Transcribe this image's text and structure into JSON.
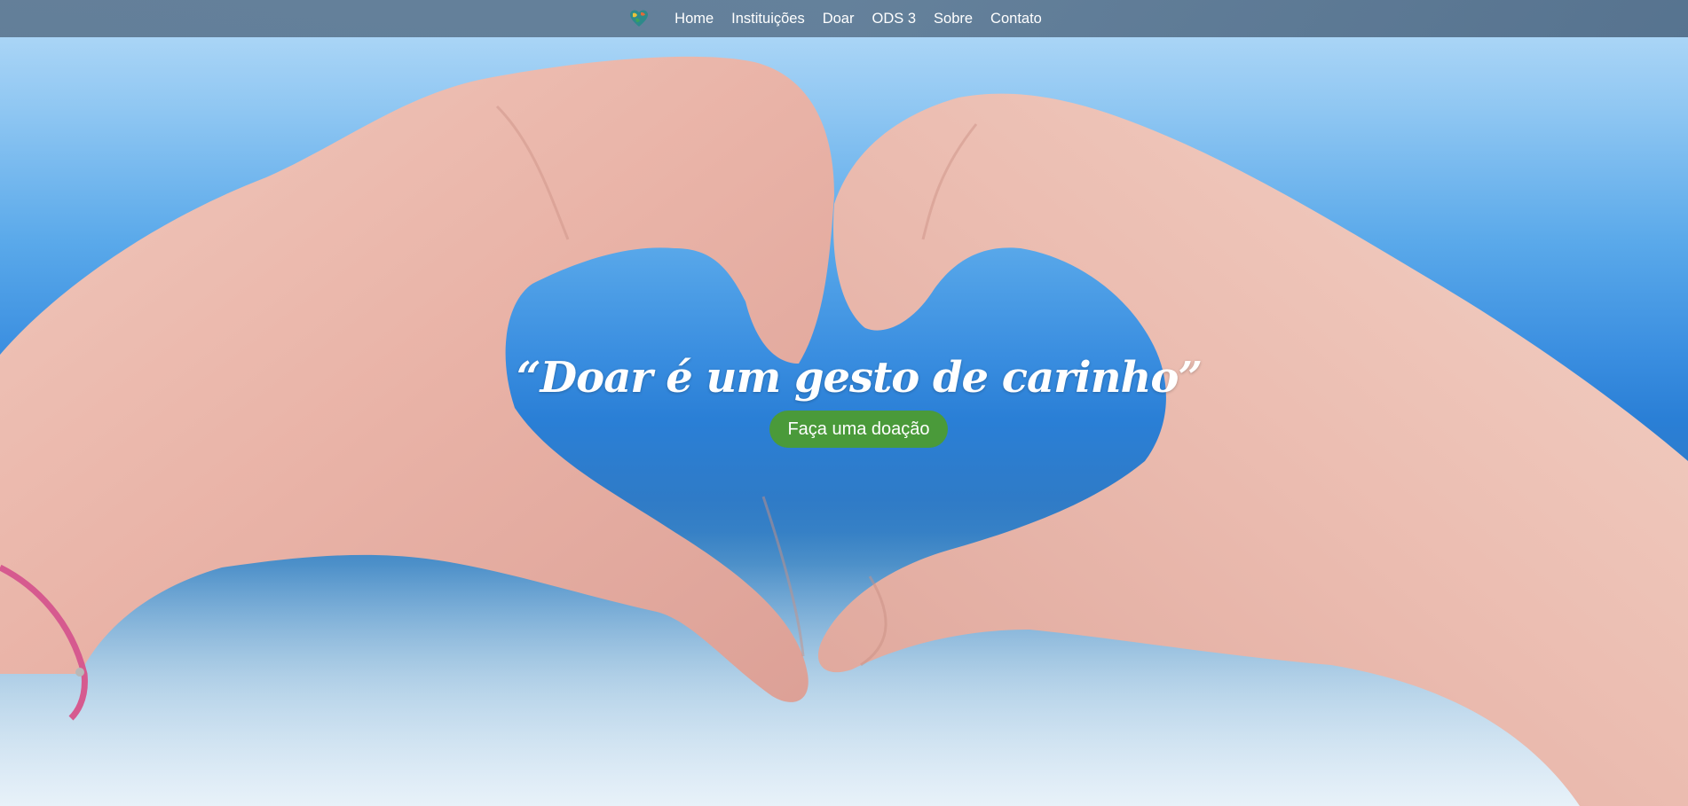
{
  "nav": {
    "logo_icon": "heart-globe-icon",
    "items": [
      {
        "label": "Home"
      },
      {
        "label": "Instituições"
      },
      {
        "label": "Doar"
      },
      {
        "label": "ODS 3"
      },
      {
        "label": "Sobre"
      },
      {
        "label": "Contato"
      }
    ]
  },
  "hero": {
    "quote": "“Doar é um gesto de carinho”",
    "cta_label": "Faça uma doação",
    "background_image": "heart-hands-photo"
  },
  "colors": {
    "navbar": "#5f7a94",
    "cta": "#4a9a3a",
    "text": "#ffffff",
    "sky": "#3a8ee0"
  }
}
